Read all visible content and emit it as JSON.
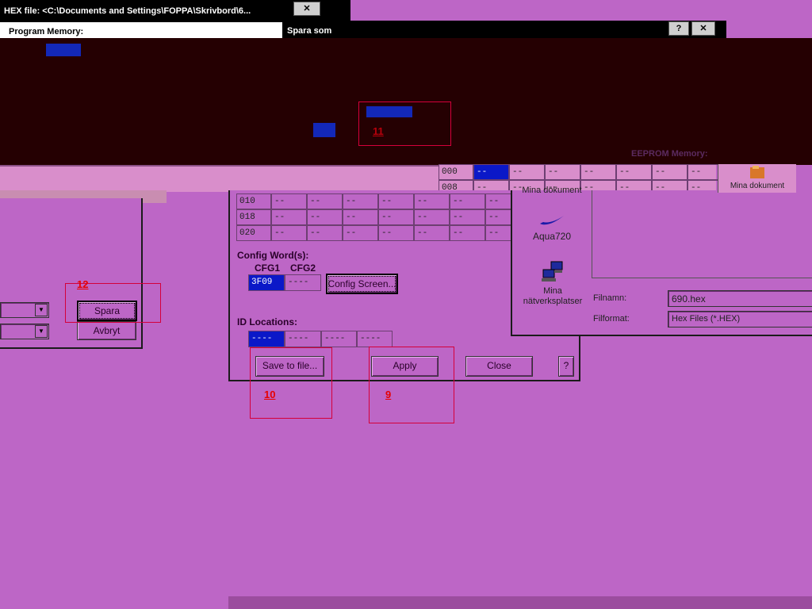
{
  "hex_window": {
    "title": "HEX file: <C:\\Documents and Settings\\FOPPA\\Skrivbord\\6...",
    "program_memory_label": "Program Memory:",
    "close_glyph": "✕"
  },
  "save_dialog": {
    "title": "Spara som",
    "help_glyph": "?",
    "close_glyph": "✕",
    "places": [
      {
        "label": "Mina dokument"
      },
      {
        "label": "Aqua720"
      },
      {
        "label": "Mina nätverksplatser"
      },
      {
        "label": "Mina dokument"
      }
    ],
    "filename_label": "Filnamn:",
    "filename_value": "690.hex",
    "filetype_label": "Filformat:",
    "filetype_value": "Hex Files (*.HEX)",
    "save_button": "Spara",
    "cancel_button": "Avbryt"
  },
  "eeprom": {
    "heading": "EEPROM Memory:",
    "rows": [
      {
        "addr": "000",
        "cells": [
          "--",
          "--",
          "--",
          "--",
          "--",
          "--",
          "--"
        ]
      },
      {
        "addr": "008",
        "cells": [
          "--",
          "--",
          "--",
          "--",
          "--",
          "--",
          "--"
        ]
      }
    ]
  },
  "program_rows": [
    {
      "addr": "010",
      "cells": [
        "--",
        "--",
        "--",
        "--",
        "--",
        "--",
        "--"
      ]
    },
    {
      "addr": "018",
      "cells": [
        "--",
        "--",
        "--",
        "--",
        "--",
        "--",
        "--"
      ]
    },
    {
      "addr": "020",
      "cells": [
        "--",
        "--",
        "--",
        "--",
        "--",
        "--",
        "--"
      ]
    }
  ],
  "config": {
    "heading": "Config Word(s):",
    "cfg1_label": "CFG1",
    "cfg2_label": "CFG2",
    "cfg1_value": "3F09",
    "cfg2_value": "----",
    "config_screen_button": "Config Screen..."
  },
  "id_locations": {
    "heading": "ID Locations:",
    "values": [
      "----",
      "----",
      "----",
      "----"
    ]
  },
  "buttons": {
    "save_to_file": "Save to file...",
    "apply": "Apply",
    "close": "Close",
    "help": "?"
  },
  "annotations": {
    "n9": "9",
    "n10": "10",
    "n11": "11",
    "n12": "12"
  },
  "colors": {
    "background": "#bd66c6",
    "selection": "#0b18c8",
    "annotation": "#e60000",
    "dark_block": "#250002"
  }
}
